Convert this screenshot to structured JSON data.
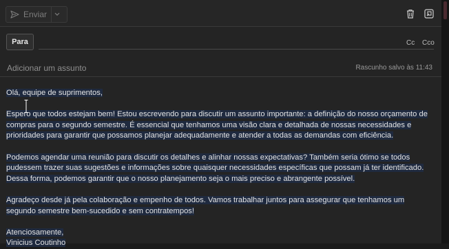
{
  "toolbar": {
    "send_label": "Enviar",
    "icons": [
      "send-icon",
      "chevron-down-icon",
      "trash-icon",
      "popout-icon"
    ]
  },
  "recipients": {
    "to_label": "Para",
    "cc_label": "Cc",
    "bcc_label": "Cco"
  },
  "subject": {
    "placeholder": "Adicionar um assunto",
    "value": ""
  },
  "draft_status": "Rascunho salvo às 11:43",
  "body": {
    "greeting": "Olá, equipe de suprimentos,",
    "paragraph1": "Espero que todos estejam bem! Estou escrevendo para discutir um assunto importante: a definição do nosso orçamento de compras para o segundo semestre. É essencial que tenhamos uma visão clara e detalhada de nossas necessidades e prioridades para garantir que possamos planejar adequadamente e atender a todas as demandas com eficiência.",
    "paragraph2": "Podemos agendar uma reunião para discutir os detalhes e alinhar nossas expectativas? Também seria ótimo se todos pudessem trazer suas sugestões e informações sobre quaisquer necessidades específicas que possam já ter identificado. Dessa forma, podemos garantir que o nosso planejamento seja o mais preciso e abrangente possível.",
    "paragraph3": "Agradeço desde já pela colaboração e empenho de todos. Vamos trabalhar juntos para assegurar que tenhamos um segundo semestre bem-sucedido e sem contratempos!",
    "closing": "Atenciosamente,",
    "signature": "Vinicius Coutinho"
  },
  "colors": {
    "background": "#242424",
    "text_highlight": "#1f2a3f"
  }
}
